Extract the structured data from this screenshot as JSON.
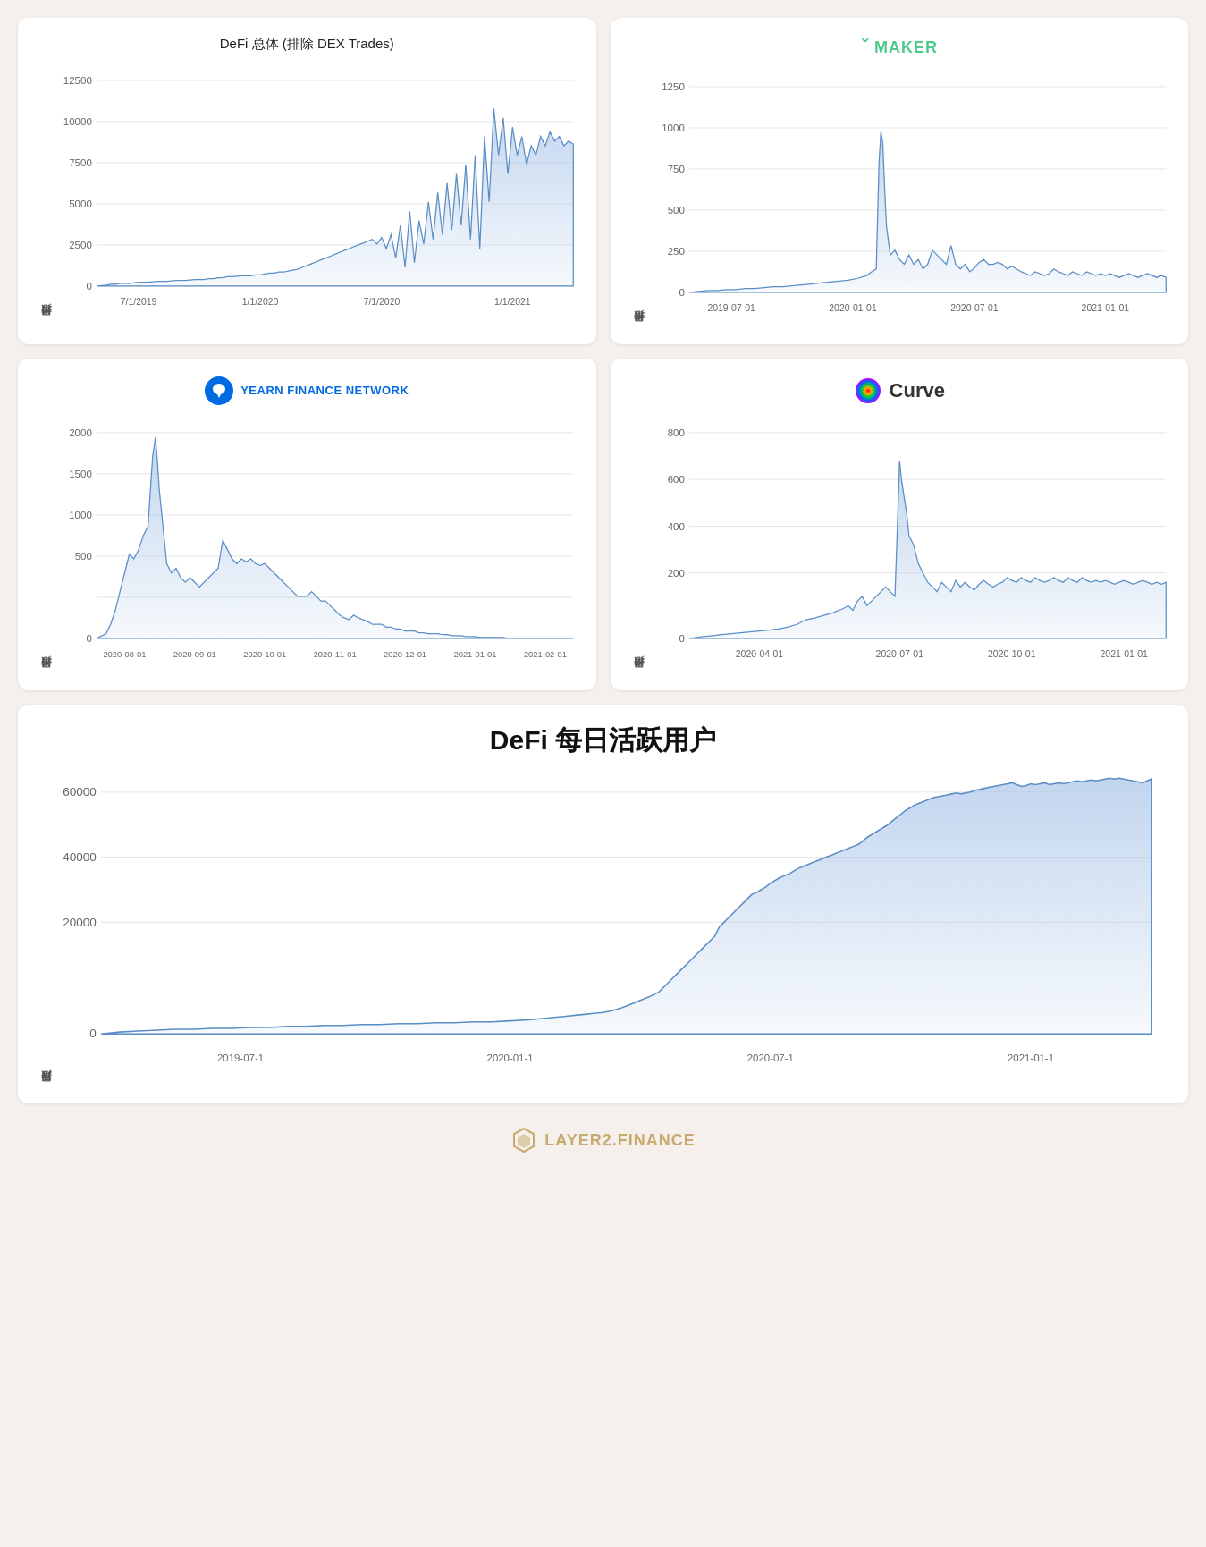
{
  "page": {
    "background": "#f5f0eb"
  },
  "charts": {
    "defi_total": {
      "title": "DeFi 总体 (排除 DEX Trades)",
      "y_label": "每日用户增长",
      "y_ticks": [
        "12500",
        "10000",
        "7500",
        "5000",
        "2500",
        "0"
      ],
      "x_ticks": [
        "7/1/2019",
        "1/1/2020",
        "7/1/2020",
        "1/1/2021"
      ]
    },
    "maker": {
      "brand": "MAKER",
      "y_label": "每日用户增长",
      "y_ticks": [
        "1250",
        "1000",
        "750",
        "500",
        "250",
        "0"
      ],
      "x_ticks": [
        "2019-07-01",
        "2020-01-01",
        "2020-07-01",
        "2021-01-01"
      ]
    },
    "yearn": {
      "brand": "YEARN FINANCE NETWORK",
      "y_label": "每日用户增长",
      "y_ticks": [
        "2000",
        "1500",
        "1000",
        "500",
        "0"
      ],
      "x_ticks": [
        "2020-08-01",
        "2020-09-01",
        "2020-10-01",
        "2020-11-01",
        "2020-12-01",
        "2021-01-01",
        "2021-02-01"
      ]
    },
    "curve": {
      "brand": "Curve",
      "y_label": "每日用户增长",
      "y_ticks": [
        "800",
        "600",
        "400",
        "200",
        "0"
      ],
      "x_ticks": [
        "2020-04-01",
        "2020-07-01",
        "2020-10-01",
        "2021-01-01"
      ]
    },
    "defi_daily": {
      "title": "DeFi 每日活跃用户",
      "y_label": "每日活跃用户",
      "y_ticks": [
        "60000",
        "40000",
        "20000",
        "0"
      ],
      "x_ticks": [
        "2019-07-1",
        "2020-01-1",
        "2020-07-1",
        "2021-01-1"
      ]
    }
  },
  "footer": {
    "brand": "LAYER2.FINANCE"
  }
}
